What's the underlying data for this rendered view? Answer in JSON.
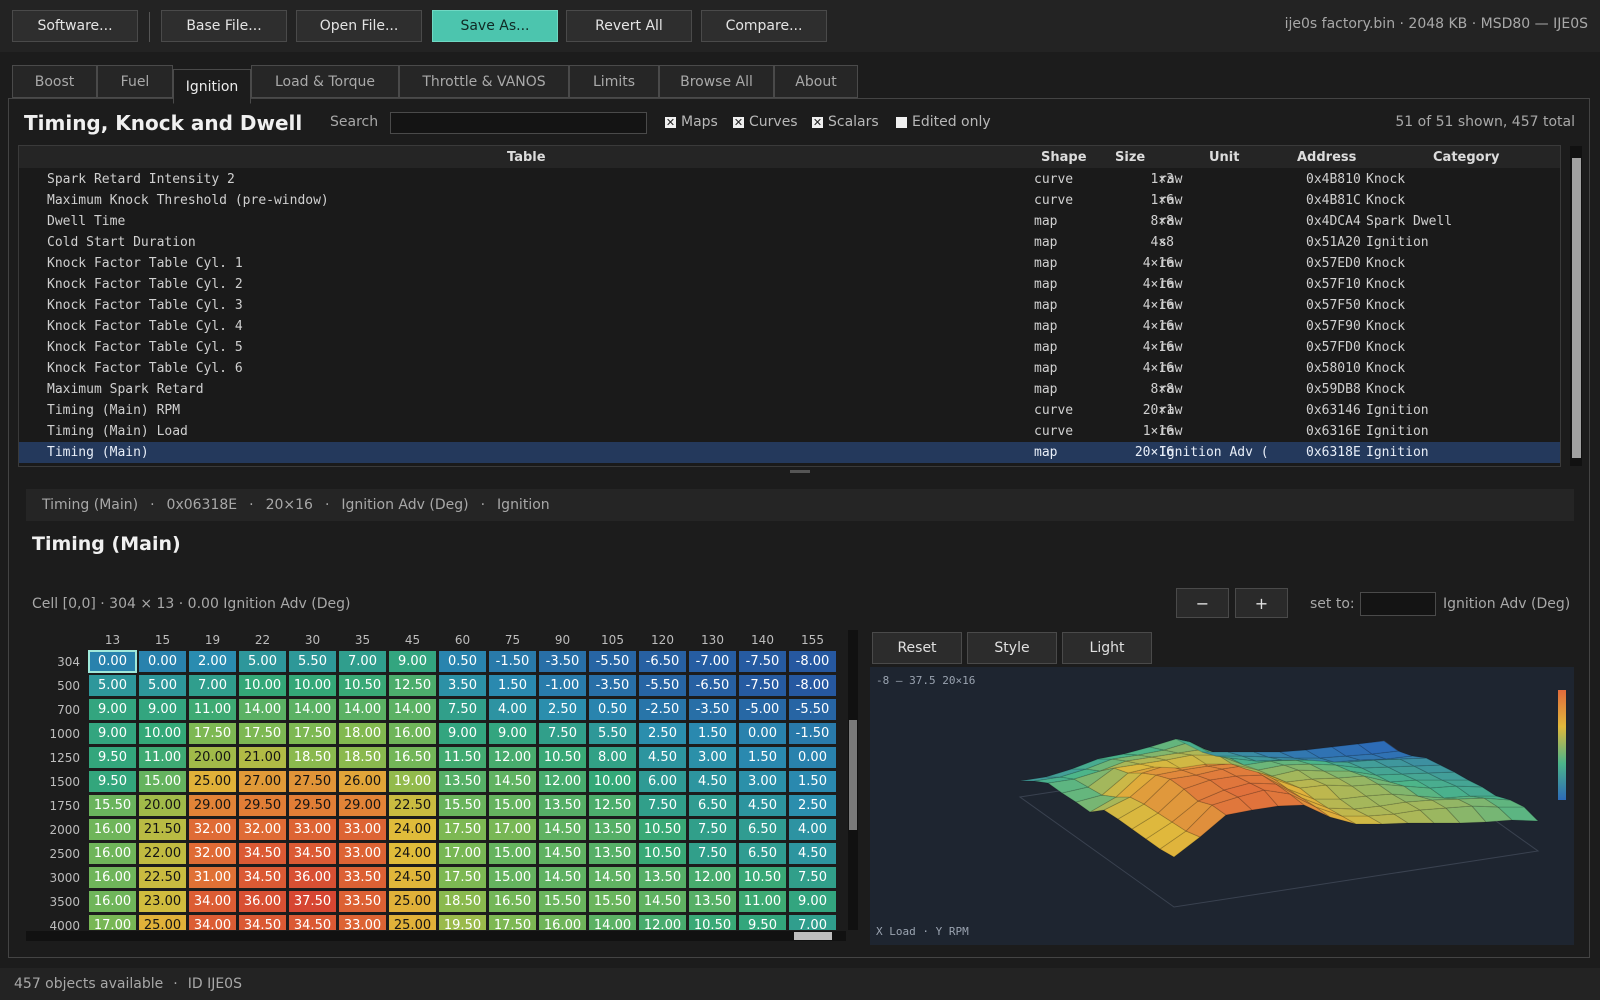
{
  "toolbar": {
    "software": "Software...",
    "base_file": "Base File...",
    "open_file": "Open File...",
    "save_as": "Save As...",
    "revert_all": "Revert All",
    "compare": "Compare...",
    "file_info": "ije0s factory.bin  ·  2048 KB  ·  MSD80 — IJE0S"
  },
  "tabs": [
    "Boost",
    "Fuel",
    "Ignition",
    "Load & Torque",
    "Throttle & VANOS",
    "Limits",
    "Browse All",
    "About"
  ],
  "active_tab": "Ignition",
  "browser": {
    "heading": "Timing, Knock and Dwell",
    "search_label": "Search",
    "search_value": "",
    "filters": {
      "maps": "Maps",
      "curves": "Curves",
      "scalars": "Scalars",
      "edited_only": "Edited only"
    },
    "filter_state": {
      "maps": true,
      "curves": true,
      "scalars": true,
      "edited_only": false
    },
    "shown_count": "51 of 51 shown, 457 total",
    "columns": [
      "Table",
      "Shape",
      "Size",
      "Unit",
      "Address",
      "Category"
    ],
    "rows": [
      [
        "Spark Retard Intensity 2",
        "curve",
        "1×3",
        "raw",
        "0x4B810",
        "Knock"
      ],
      [
        "Maximum Knock Threshold (pre-window)",
        "curve",
        "1×6",
        "raw",
        "0x4B81C",
        "Knock"
      ],
      [
        "Dwell Time",
        "map",
        "8×8",
        "raw",
        "0x4DCA4",
        "Spark Dwell"
      ],
      [
        "Cold Start Duration",
        "map",
        "4×8",
        "s",
        "0x51A20",
        "Ignition"
      ],
      [
        "Knock Factor Table Cyl. 1",
        "map",
        "4×16",
        "raw",
        "0x57ED0",
        "Knock"
      ],
      [
        "Knock Factor Table Cyl. 2",
        "map",
        "4×16",
        "raw",
        "0x57F10",
        "Knock"
      ],
      [
        "Knock Factor Table Cyl. 3",
        "map",
        "4×16",
        "raw",
        "0x57F50",
        "Knock"
      ],
      [
        "Knock Factor Table Cyl. 4",
        "map",
        "4×16",
        "raw",
        "0x57F90",
        "Knock"
      ],
      [
        "Knock Factor Table Cyl. 5",
        "map",
        "4×16",
        "raw",
        "0x57FD0",
        "Knock"
      ],
      [
        "Knock Factor Table Cyl. 6",
        "map",
        "4×16",
        "raw",
        "0x58010",
        "Knock"
      ],
      [
        "Maximum Spark Retard",
        "map",
        "8×8",
        "raw",
        "0x59DB8",
        "Knock"
      ],
      [
        "Timing (Main) RPM",
        "curve",
        "20×1",
        "raw",
        "0x63146",
        "Ignition"
      ],
      [
        "Timing (Main) Load",
        "curve",
        "1×16",
        "raw",
        "0x6316E",
        "Ignition"
      ],
      [
        "Timing (Main)",
        "map",
        "20×16",
        "Ignition Adv (",
        "0x6318E",
        "Ignition"
      ]
    ],
    "selected_row": 13
  },
  "info_bar": [
    "Timing (Main)",
    "·",
    "0x06318E",
    "·",
    "20×16",
    "·",
    "Ignition Adv (Deg)",
    "·",
    "Ignition"
  ],
  "editor": {
    "title": "Timing (Main)",
    "cell_info": "Cell [0,0]  ·  304 × 13  ·  0.00 Ignition Adv (Deg)",
    "minus": "−",
    "plus": "+",
    "set_to_label": "set to:",
    "set_to_value": "",
    "unit": "Ignition Adv (Deg)",
    "col_headers": [
      "13",
      "15",
      "19",
      "22",
      "30",
      "35",
      "45",
      "60",
      "75",
      "90",
      "105",
      "120",
      "130",
      "140",
      "155"
    ],
    "row_headers": [
      "304",
      "500",
      "700",
      "1000",
      "1250",
      "1500",
      "1750",
      "2000",
      "2500",
      "3000",
      "3500",
      "4000"
    ],
    "values": [
      [
        "0.00",
        "0.00",
        "2.00",
        "5.00",
        "5.50",
        "7.00",
        "9.00",
        "0.50",
        "-1.50",
        "-3.50",
        "-5.50",
        "-6.50",
        "-7.00",
        "-7.50",
        "-8.00"
      ],
      [
        "5.00",
        "5.00",
        "7.00",
        "10.00",
        "10.00",
        "10.50",
        "12.50",
        "3.50",
        "1.50",
        "-1.00",
        "-3.50",
        "-5.50",
        "-6.50",
        "-7.50",
        "-8.00"
      ],
      [
        "9.00",
        "9.00",
        "11.00",
        "14.00",
        "14.00",
        "14.00",
        "14.00",
        "7.50",
        "4.00",
        "2.50",
        "0.50",
        "-2.50",
        "-3.50",
        "-5.00",
        "-5.50"
      ],
      [
        "9.00",
        "10.00",
        "17.50",
        "17.50",
        "17.50",
        "18.00",
        "16.00",
        "9.00",
        "9.00",
        "7.50",
        "5.50",
        "2.50",
        "1.50",
        "0.00",
        "-1.50"
      ],
      [
        "9.50",
        "11.00",
        "20.00",
        "21.00",
        "18.50",
        "18.50",
        "16.50",
        "11.50",
        "12.00",
        "10.50",
        "8.00",
        "4.50",
        "3.00",
        "1.50",
        "0.00"
      ],
      [
        "9.50",
        "15.00",
        "25.00",
        "27.00",
        "27.50",
        "26.00",
        "19.00",
        "13.50",
        "14.50",
        "12.00",
        "10.00",
        "6.00",
        "4.50",
        "3.00",
        "1.50"
      ],
      [
        "15.50",
        "20.00",
        "29.00",
        "29.50",
        "29.50",
        "29.00",
        "22.50",
        "15.50",
        "15.00",
        "13.50",
        "12.50",
        "7.50",
        "6.50",
        "4.50",
        "2.50"
      ],
      [
        "16.00",
        "21.50",
        "32.00",
        "32.00",
        "33.00",
        "33.00",
        "24.00",
        "17.50",
        "17.00",
        "14.50",
        "13.50",
        "10.50",
        "7.50",
        "6.50",
        "4.00"
      ],
      [
        "16.00",
        "22.00",
        "32.00",
        "34.50",
        "34.50",
        "33.00",
        "24.00",
        "17.00",
        "15.00",
        "14.50",
        "13.50",
        "10.50",
        "7.50",
        "6.50",
        "4.50"
      ],
      [
        "16.00",
        "22.50",
        "31.00",
        "34.50",
        "36.00",
        "33.50",
        "24.50",
        "17.50",
        "15.00",
        "14.50",
        "14.50",
        "13.50",
        "12.00",
        "10.50",
        "7.50"
      ],
      [
        "16.00",
        "23.00",
        "34.00",
        "36.00",
        "37.50",
        "33.50",
        "25.00",
        "18.50",
        "16.50",
        "15.50",
        "15.50",
        "14.50",
        "13.50",
        "11.00",
        "9.00"
      ],
      [
        "17.00",
        "25.00",
        "34.00",
        "34.50",
        "34.50",
        "33.00",
        "25.00",
        "19.50",
        "17.50",
        "16.00",
        "14.00",
        "12.00",
        "10.50",
        "9.50",
        "7.00"
      ]
    ]
  },
  "view3d": {
    "reset": "Reset",
    "style": "Style",
    "light": "Light",
    "range": "-8 – 37.5   20×16",
    "axes": "X Load · Y RPM",
    "min": -8,
    "max": 37.5
  },
  "status": {
    "objects": "457 objects available",
    "sep": "·",
    "id": "ID IJE0S"
  }
}
